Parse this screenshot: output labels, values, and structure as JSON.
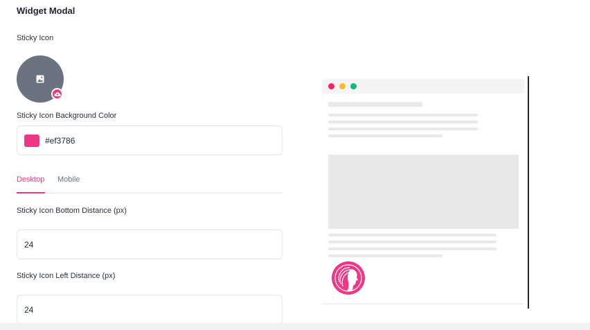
{
  "title": "Widget Modal",
  "sticky_icon": {
    "label": "Sticky Icon"
  },
  "bg_color": {
    "label": "Sticky Icon Background Color",
    "value": "#ef3786"
  },
  "tabs": [
    {
      "label": "Desktop",
      "active": true
    },
    {
      "label": "Mobile",
      "active": false
    }
  ],
  "bottom_distance": {
    "label": "Sticky Icon Bottom Distance (px)",
    "value": "24"
  },
  "left_distance": {
    "label": "Sticky Icon Left Distance (px)",
    "value": "24"
  },
  "colors": {
    "accent": "#ef3786",
    "dot_red": "#ff1f6b",
    "dot_yellow": "#fbbf24",
    "dot_green": "#10b981",
    "avatar": "#6b7280"
  },
  "icons": [
    "image-icon",
    "cloud-upload-icon",
    "woman-profile-logo"
  ]
}
